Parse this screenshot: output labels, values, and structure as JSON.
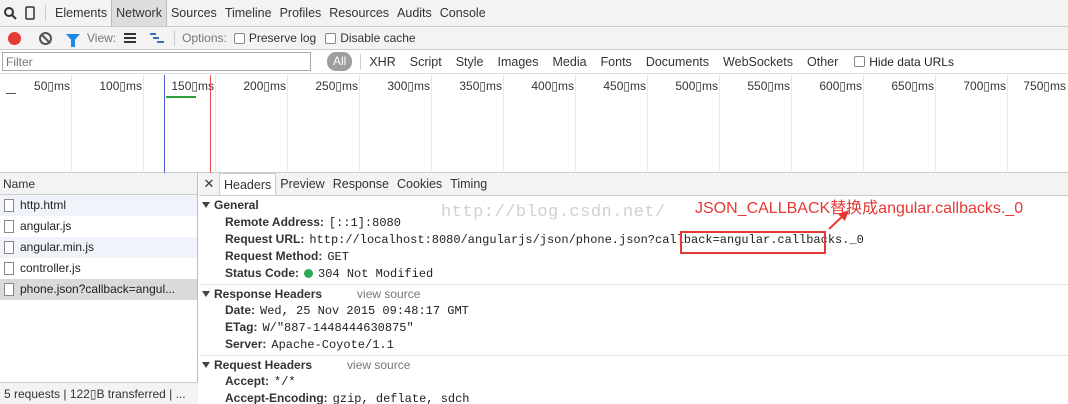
{
  "topbar": {
    "tabs": [
      "Elements",
      "Network",
      "Sources",
      "Timeline",
      "Profiles",
      "Resources",
      "Audits",
      "Console"
    ],
    "selected": "Network",
    "icons": [
      "search-icon",
      "device-icon"
    ]
  },
  "toolbar": {
    "view_label": "View:",
    "options_label": "Options:",
    "preserve_log": "Preserve log",
    "disable_cache": "Disable cache"
  },
  "filter": {
    "placeholder": "Filter",
    "all_label": "All",
    "types": [
      "XHR",
      "Script",
      "Style",
      "Images",
      "Media",
      "Fonts",
      "Documents",
      "WebSockets",
      "Other"
    ],
    "hide_data_urls": "Hide data URLs"
  },
  "timeline": {
    "ticks": [
      "50▯ms",
      "100▯ms",
      "150▯ms",
      "200▯ms",
      "250▯ms",
      "300▯ms",
      "350▯ms",
      "400▯ms",
      "450▯ms",
      "500▯ms",
      "550▯ms",
      "600▯ms",
      "650▯ms",
      "700▯ms",
      "750▯ms"
    ]
  },
  "requests": {
    "header": "Name",
    "items": [
      "http.html",
      "angular.js",
      "angular.min.js",
      "controller.js",
      "phone.json?callback=angul..."
    ],
    "footer": "5 requests | 122▯B transferred | ..."
  },
  "details": {
    "tabs": [
      "Headers",
      "Preview",
      "Response",
      "Cookies",
      "Timing"
    ],
    "selected_tab": "Headers",
    "general": {
      "title": "General",
      "remote_address_k": "Remote Address:",
      "remote_address_v": "[::1]:8080",
      "request_url_k": "Request URL:",
      "request_url_v": "http://localhost:8080/angularjs/json/phone.json?callback=angular.callbacks._0",
      "request_method_k": "Request Method:",
      "request_method_v": "GET",
      "status_code_k": "Status Code:",
      "status_code_v": "304 Not Modified"
    },
    "response_headers": {
      "title": "Response Headers",
      "view_source": "view source",
      "date_k": "Date:",
      "date_v": "Wed, 25 Nov 2015 09:48:17 GMT",
      "etag_k": "ETag:",
      "etag_v": "W/\"887-1448444630875\"",
      "server_k": "Server:",
      "server_v": "Apache-Coyote/1.1"
    },
    "request_headers": {
      "title": "Request Headers",
      "view_source": "view source",
      "accept_k": "Accept:",
      "accept_v": "*/*",
      "accept_encoding_k": "Accept-Encoding:",
      "accept_encoding_v": "gzip, deflate, sdch"
    }
  },
  "annotation": {
    "text": "JSON_CALLBACK替换成angular.callbacks._0",
    "watermark": "http://blog.csdn.net/",
    "color": "#e53935"
  }
}
